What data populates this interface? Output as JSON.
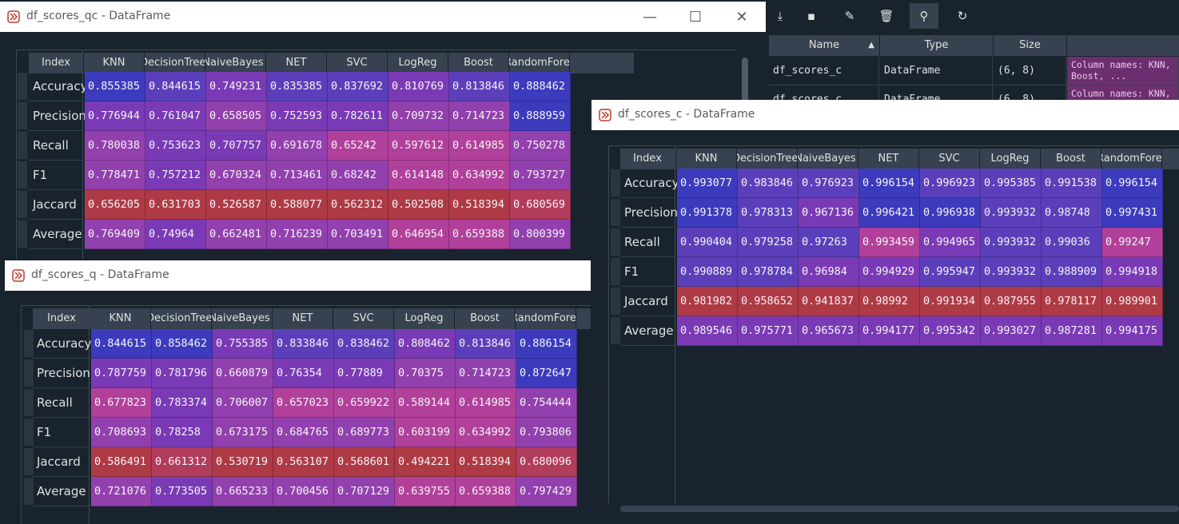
{
  "colors": {
    "blue": "#3c3bbe",
    "indigo": "#5b3fba",
    "violet": "#7a3ab6",
    "purple": "#9240ad",
    "magenta": "#b1409b",
    "rose": "#b13c5c",
    "red": "#ae3a46",
    "bg": "#19232d",
    "header": "#37414f"
  },
  "variable_explorer": {
    "toolbar_icons": [
      "download-icon",
      "save-icon",
      "save-as-icon",
      "delete-icon",
      "search-icon",
      "refresh-icon"
    ],
    "toolbar_glyphs": [
      "⤓",
      "▪",
      "✎",
      "🗑",
      "⚲",
      "↻"
    ],
    "headers": {
      "name": "Name",
      "type": "Type",
      "size": "Size"
    },
    "rows": [
      {
        "name": "df_scores_c",
        "type": "DataFrame",
        "size": "(6, 8)",
        "value": "Column names: KNN,\nBoost, ..."
      },
      {
        "name": "df_scores_c",
        "type": "DataFrame",
        "size": "(6, 8)",
        "value": "Column names: KNN,"
      }
    ]
  },
  "columns": [
    "KNN",
    "DecisionTree",
    "NaiveBayes",
    "NET",
    "SVC",
    "LogReg",
    "Boost",
    "RandomFore"
  ],
  "index_header": "Index",
  "index": [
    "Accuracy",
    "Precision",
    "Recall",
    "F1",
    "Jaccard",
    "Average"
  ],
  "windows": {
    "qc": {
      "title": "df_scores_qc - DataFrame",
      "controls": {
        "minimize": "—",
        "maximize": "☐",
        "close": "✕"
      },
      "values": [
        [
          "0.855385",
          "0.844615",
          "0.749231",
          "0.835385",
          "0.837692",
          "0.810769",
          "0.813846",
          "0.888462"
        ],
        [
          "0.776944",
          "0.761047",
          "0.658505",
          "0.752593",
          "0.782611",
          "0.709732",
          "0.714723",
          "0.888959"
        ],
        [
          "0.780038",
          "0.753623",
          "0.707757",
          "0.691678",
          "0.65242",
          "0.597612",
          "0.614985",
          "0.750278"
        ],
        [
          "0.778471",
          "0.757212",
          "0.670324",
          "0.713461",
          "0.68242",
          "0.614148",
          "0.634992",
          "0.793727"
        ],
        [
          "0.656205",
          "0.631703",
          "0.526587",
          "0.588077",
          "0.562312",
          "0.502508",
          "0.518394",
          "0.680569"
        ],
        [
          "0.769409",
          "0.74964",
          "0.662481",
          "0.716239",
          "0.703491",
          "0.646954",
          "0.659388",
          "0.800399"
        ]
      ],
      "tones": [
        [
          "blue",
          "indigo",
          "violet",
          "indigo",
          "indigo",
          "violet",
          "indigo",
          "blue"
        ],
        [
          "violet",
          "violet",
          "purple",
          "violet",
          "violet",
          "purple",
          "purple",
          "blue"
        ],
        [
          "purple",
          "violet",
          "violet",
          "purple",
          "magenta",
          "magenta",
          "magenta",
          "purple"
        ],
        [
          "purple",
          "violet",
          "purple",
          "purple",
          "purple",
          "magenta",
          "magenta",
          "purple"
        ],
        [
          "red",
          "red",
          "red",
          "red",
          "red",
          "red",
          "red",
          "rose"
        ],
        [
          "purple",
          "violet",
          "purple",
          "purple",
          "purple",
          "magenta",
          "magenta",
          "purple"
        ]
      ]
    },
    "q": {
      "title": "df_scores_q - DataFrame",
      "values": [
        [
          "0.844615",
          "0.858462",
          "0.755385",
          "0.833846",
          "0.838462",
          "0.808462",
          "0.813846",
          "0.886154"
        ],
        [
          "0.787759",
          "0.781796",
          "0.660879",
          "0.76354",
          "0.77889",
          "0.70375",
          "0.714723",
          "0.872647"
        ],
        [
          "0.677823",
          "0.783374",
          "0.706007",
          "0.657023",
          "0.659922",
          "0.589144",
          "0.614985",
          "0.754444"
        ],
        [
          "0.708693",
          "0.78258",
          "0.673175",
          "0.684765",
          "0.689773",
          "0.603199",
          "0.634992",
          "0.793806"
        ],
        [
          "0.586491",
          "0.661312",
          "0.530719",
          "0.563107",
          "0.568601",
          "0.494221",
          "0.518394",
          "0.680096"
        ],
        [
          "0.721076",
          "0.773505",
          "0.665233",
          "0.700456",
          "0.707129",
          "0.639755",
          "0.659388",
          "0.797429"
        ]
      ],
      "tones": [
        [
          "blue",
          "blue",
          "violet",
          "indigo",
          "indigo",
          "violet",
          "indigo",
          "blue"
        ],
        [
          "violet",
          "violet",
          "purple",
          "violet",
          "violet",
          "purple",
          "purple",
          "blue"
        ],
        [
          "magenta",
          "violet",
          "purple",
          "magenta",
          "magenta",
          "magenta",
          "magenta",
          "purple"
        ],
        [
          "purple",
          "violet",
          "purple",
          "purple",
          "purple",
          "magenta",
          "magenta",
          "purple"
        ],
        [
          "red",
          "rose",
          "red",
          "red",
          "red",
          "red",
          "red",
          "rose"
        ],
        [
          "purple",
          "violet",
          "purple",
          "purple",
          "purple",
          "magenta",
          "magenta",
          "purple"
        ]
      ]
    },
    "c": {
      "title": "df_scores_c - DataFrame",
      "values": [
        [
          "0.993077",
          "0.983846",
          "0.976923",
          "0.996154",
          "0.996923",
          "0.995385",
          "0.991538",
          "0.996154"
        ],
        [
          "0.991378",
          "0.978313",
          "0.967136",
          "0.996421",
          "0.996938",
          "0.993932",
          "0.98748",
          "0.997431"
        ],
        [
          "0.990404",
          "0.979258",
          "0.97263",
          "0.993459",
          "0.994965",
          "0.993932",
          "0.99036",
          "0.99247"
        ],
        [
          "0.990889",
          "0.978784",
          "0.96984",
          "0.994929",
          "0.995947",
          "0.993932",
          "0.988909",
          "0.994918"
        ],
        [
          "0.981982",
          "0.958652",
          "0.941837",
          "0.98992",
          "0.991934",
          "0.987955",
          "0.978117",
          "0.989901"
        ],
        [
          "0.989546",
          "0.975771",
          "0.965673",
          "0.994177",
          "0.995342",
          "0.993027",
          "0.987281",
          "0.994175"
        ]
      ],
      "tones": [
        [
          "blue",
          "indigo",
          "indigo",
          "blue",
          "indigo",
          "indigo",
          "indigo",
          "blue"
        ],
        [
          "blue",
          "indigo",
          "violet",
          "blue",
          "blue",
          "indigo",
          "indigo",
          "blue"
        ],
        [
          "indigo",
          "indigo",
          "indigo",
          "magenta",
          "violet",
          "indigo",
          "indigo",
          "magenta"
        ],
        [
          "indigo",
          "indigo",
          "violet",
          "violet",
          "indigo",
          "indigo",
          "indigo",
          "violet"
        ],
        [
          "red",
          "red",
          "red",
          "red",
          "red",
          "red",
          "red",
          "red"
        ],
        [
          "violet",
          "violet",
          "violet",
          "violet",
          "violet",
          "violet",
          "violet",
          "violet"
        ]
      ]
    }
  }
}
